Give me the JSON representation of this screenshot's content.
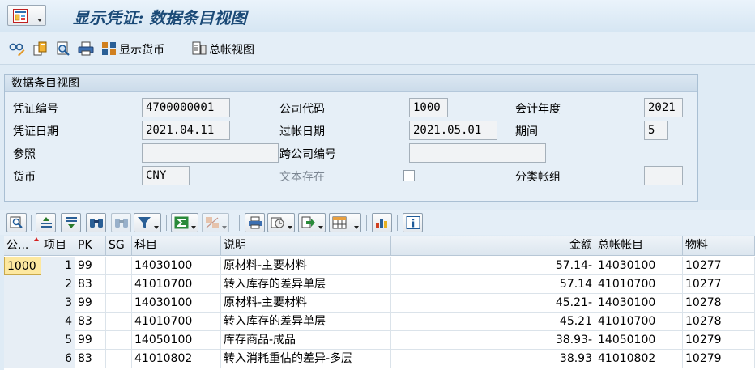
{
  "header": {
    "title": "显示凭证: 数据条目视图"
  },
  "toolbar": {
    "icons": [
      "glasses-edit-icon",
      "copy-document-icon",
      "display-document-icon",
      "printer-icon",
      "currency-icon",
      "ledger-view-icon"
    ],
    "display_currency_label": "显示货币",
    "ledger_view_label": "总帐视图"
  },
  "group": {
    "title": "数据条目视图",
    "doc_number_label": "凭证编号",
    "doc_number": "4700000001",
    "company_code_label": "公司代码",
    "company_code": "1000",
    "fiscal_year_label": "会计年度",
    "fiscal_year": "2021",
    "doc_date_label": "凭证日期",
    "doc_date": "2021.04.11",
    "posting_date_label": "过帐日期",
    "posting_date": "2021.05.01",
    "period_label": "期间",
    "period": "5",
    "reference_label": "参照",
    "reference": "",
    "cross_cc_label": "跨公司编号",
    "cross_cc": "",
    "currency_label": "货币",
    "currency": "CNY",
    "text_exists_label": "文本存在",
    "ledger_group_label": "分类帐组",
    "ledger_group": ""
  },
  "grid": {
    "columns": [
      "公...",
      "项目",
      "PK",
      "SG",
      "科目",
      "说明",
      "金额",
      "总帐帐目",
      "物料"
    ],
    "rows": [
      {
        "company": "1000",
        "item": "1",
        "pk": "99",
        "sg": "",
        "account": "14030100",
        "text": "原材料-主要材料",
        "amount": "57.14-",
        "gl": "14030100",
        "material": "10277"
      },
      {
        "company": "",
        "item": "2",
        "pk": "83",
        "sg": "",
        "account": "41010700",
        "text": "转入库存的差异单层",
        "amount": "57.14",
        "gl": "41010700",
        "material": "10277"
      },
      {
        "company": "",
        "item": "3",
        "pk": "99",
        "sg": "",
        "account": "14030100",
        "text": "原材料-主要材料",
        "amount": "45.21-",
        "gl": "14030100",
        "material": "10278"
      },
      {
        "company": "",
        "item": "4",
        "pk": "83",
        "sg": "",
        "account": "41010700",
        "text": "转入库存的差异单层",
        "amount": "45.21",
        "gl": "41010700",
        "material": "10278"
      },
      {
        "company": "",
        "item": "5",
        "pk": "99",
        "sg": "",
        "account": "14050100",
        "text": "库存商品-成品",
        "amount": "38.93-",
        "gl": "14050100",
        "material": "10279"
      },
      {
        "company": "",
        "item": "6",
        "pk": "83",
        "sg": "",
        "account": "41010802",
        "text": "转入消耗重估的差异-多层",
        "amount": "38.93",
        "gl": "41010802",
        "material": "10279"
      }
    ]
  },
  "colors": {
    "title": "#1b4a77",
    "background": "#dfebf5",
    "selected_cell": "#fde8a0"
  }
}
